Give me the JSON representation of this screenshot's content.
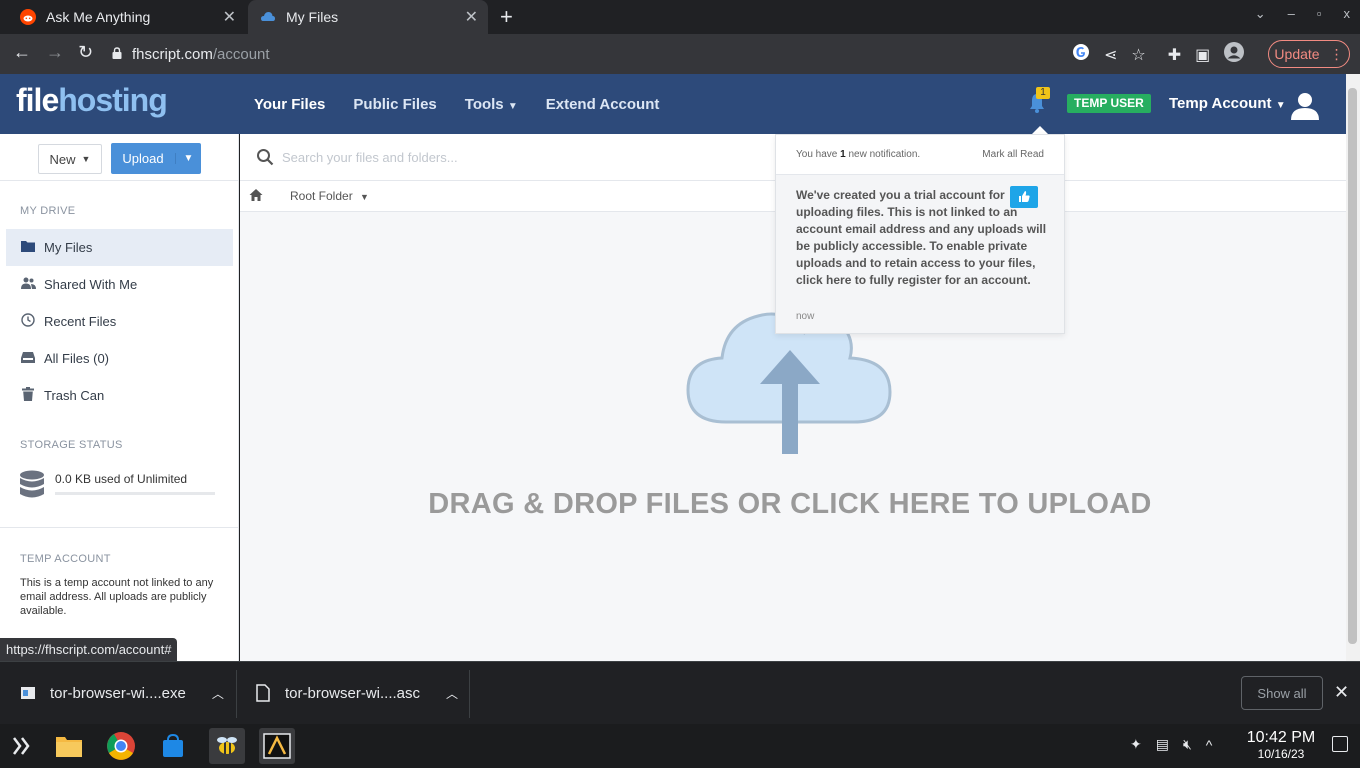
{
  "browser": {
    "tabs": [
      {
        "title": "Ask Me Anything",
        "active": false
      },
      {
        "title": "My Files",
        "active": true
      }
    ],
    "url_host": "fhscript.com",
    "url_path": "/account",
    "update_label": "Update",
    "status_url": "https://fhscript.com/account#"
  },
  "site": {
    "logo_part1": "file",
    "logo_part2": "hosting",
    "nav": [
      "Your Files",
      "Public Files",
      "Tools",
      "Extend Account"
    ],
    "notification_count": "1",
    "temp_badge": "TEMP USER",
    "account_label": "Temp Account"
  },
  "sidebar": {
    "new_label": "New",
    "upload_label": "Upload",
    "my_drive_heading": "MY DRIVE",
    "items": [
      "My Files",
      "Shared With Me",
      "Recent Files",
      "All Files (0)",
      "Trash Can"
    ],
    "storage_heading": "STORAGE STATUS",
    "storage_text": "0.0 KB used of Unlimited",
    "storage_used_fraction": 0,
    "temp_heading": "TEMP ACCOUNT",
    "temp_text": "This is a temp account not linked to any email address. All uploads are publicly available."
  },
  "content": {
    "search_placeholder": "Search your files and folders...",
    "breadcrumb": "Root Folder",
    "drop_text": "DRAG & DROP FILES OR CLICK HERE TO UPLOAD"
  },
  "notification": {
    "count_prefix": "You have ",
    "count": "1",
    "count_suffix": " new notification.",
    "mark_all": "Mark all Read",
    "message": "We've created you a trial account for uploading files. This is not linked to an account email address and any uploads will be publicly accessible. To enable private uploads and to retain access to your files, click here to fully register for an account.",
    "time": "now"
  },
  "downloads": {
    "items": [
      "tor-browser-wi....exe",
      "tor-browser-wi....asc"
    ],
    "show_all": "Show all"
  },
  "taskbar": {
    "time": "10:42 PM",
    "date": "10/16/23"
  },
  "colors": {
    "header": "#2d4a7a",
    "accent": "#4a90d9",
    "temp_badge": "#27ae60"
  }
}
